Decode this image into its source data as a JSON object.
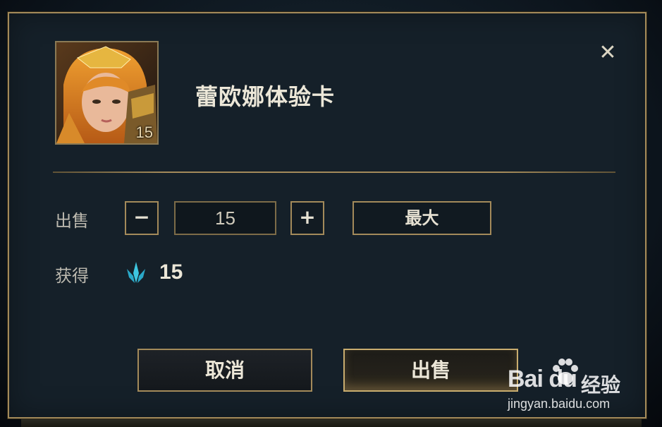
{
  "dialog": {
    "item_name": "蕾欧娜体验卡",
    "item_count": "15",
    "close_symbol": "✕",
    "sell_label": "出售",
    "gain_label": "获得",
    "minus_symbol": "−",
    "plus_symbol": "+",
    "quantity_value": "15",
    "max_label": "最大",
    "gain_value": "15",
    "gain_icon": "blue-essence-icon",
    "cancel_label": "取消",
    "confirm_label": "出售"
  },
  "colors": {
    "dialog_bg": "#152029",
    "gold_border": "#a38a5a",
    "essence_blue": "#3ec6e0",
    "text_primary": "#ece7d8"
  },
  "watermark": {
    "brand_latin": "Bai du",
    "brand_cn": "经验",
    "url": "jingyan.baidu.com"
  }
}
